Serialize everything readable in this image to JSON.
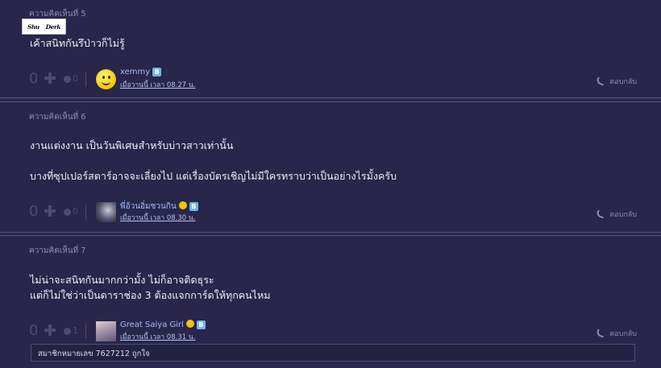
{
  "comments": [
    {
      "title": "ความคิดเห็นที่ 5",
      "sticker_left": "Shu",
      "sticker_right": "Derk",
      "lines": [
        "เค้าสนิทกันรึป่าวก็ไม่รู้"
      ],
      "votes": "0",
      "emotions": "0",
      "user": "xemmy",
      "badge": "B",
      "time": "เมื่อวานนี้ เวลา 08.27 น.",
      "reply": "ตอบกลับ"
    },
    {
      "title": "ความคิดเห็นที่ 6",
      "lines": [
        "งานแต่งงาน เป็นวันพิเศษสำหรับบ่าวสาวเท่านั้น",
        "บางที่ซุปเปอร์สตาร์อาจจะเลี่ยงไป แต่เรื่องบัตรเชิญไม่มีใครทราบว่าเป็นอย่างไรมั้งครับ"
      ],
      "votes": "0",
      "emotions": "0",
      "user": "พี่อ้วนอิ่มชวนกิน",
      "badge": "B",
      "time": "เมื่อวานนี้ เวลา 08.30 น.",
      "reply": "ตอบกลับ"
    },
    {
      "title": "ความคิดเห็นที่ 7",
      "lines": [
        "ไม่น่าจะสนิทกันมากกว่ามั้ง ไม่ก็อาจติดธุระ",
        "แต่ก็ไม่ใช่ว่าเป็นดาราช่อง 3 ต้องแจกการ์ดให้ทุกคนไหม"
      ],
      "votes": "0",
      "emotions": "1",
      "user": "Great Saiya Girl",
      "badge": "B",
      "time": "เมื่อวานนี้ เวลา 08.31 น.",
      "reply": "ตอบกลับ",
      "sub_reply": "สมาชิกหมายเลข 7627212 ถูกใจ"
    }
  ]
}
